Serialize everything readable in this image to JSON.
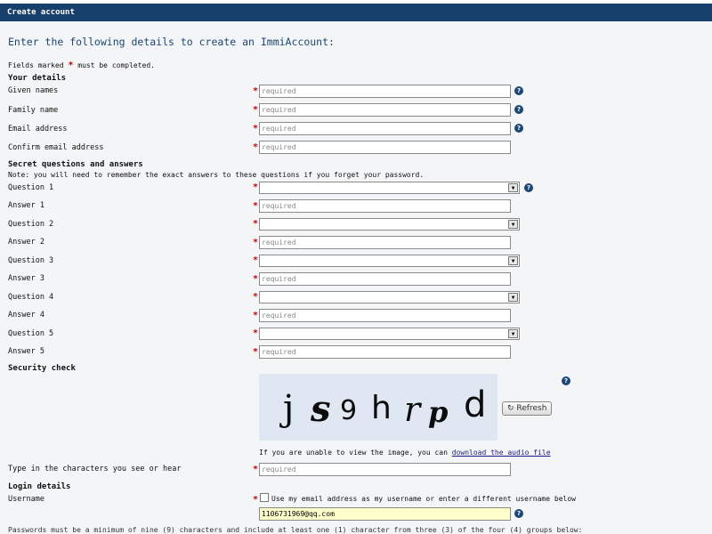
{
  "header": {
    "title": "Create account"
  },
  "intro": "Enter the following details to create an ImmiAccount:",
  "fields_note": {
    "before": "Fields marked ",
    "asterisk": "*",
    "after": " must be completed."
  },
  "sections": {
    "your_details": "Your details",
    "secret": "Secret questions and answers",
    "security": "Security check",
    "login": "Login details"
  },
  "secret_note": "Note: you will need to remember the exact answers to these questions if you forget your password.",
  "labels": {
    "given_names": "Given names",
    "family_name": "Family name",
    "email": "Email address",
    "confirm_email": "Confirm email address",
    "question_1": "Question 1",
    "answer_1": "Answer 1",
    "question_2": "Question 2",
    "answer_2": "Answer 2",
    "question_3": "Question 3",
    "answer_3": "Answer 3",
    "question_4": "Question 4",
    "answer_4": "Answer 4",
    "question_5": "Question 5",
    "answer_5": "Answer 5",
    "captcha_input": "Type in the characters you see or hear",
    "username": "Username"
  },
  "placeholder": "required",
  "asterisk": "*",
  "help_glyph": "?",
  "select_arrow": "▼",
  "captcha": {
    "characters": [
      "j",
      "s",
      "9",
      "h",
      "r",
      "p",
      "d"
    ],
    "refresh_label": "Refresh",
    "refresh_icon": "↻",
    "audio_text": "If you are unable to view the image, you can ",
    "audio_link": "download the audio file"
  },
  "login": {
    "checkbox_label": "Use my email address as my username or enter a different username below",
    "username_value": "1106731969@qq.com"
  },
  "cutoff_text": "Passwords must be a minimum of nine (9) characters and include at least one (1) character from three (3) of the four (4) groups below:"
}
